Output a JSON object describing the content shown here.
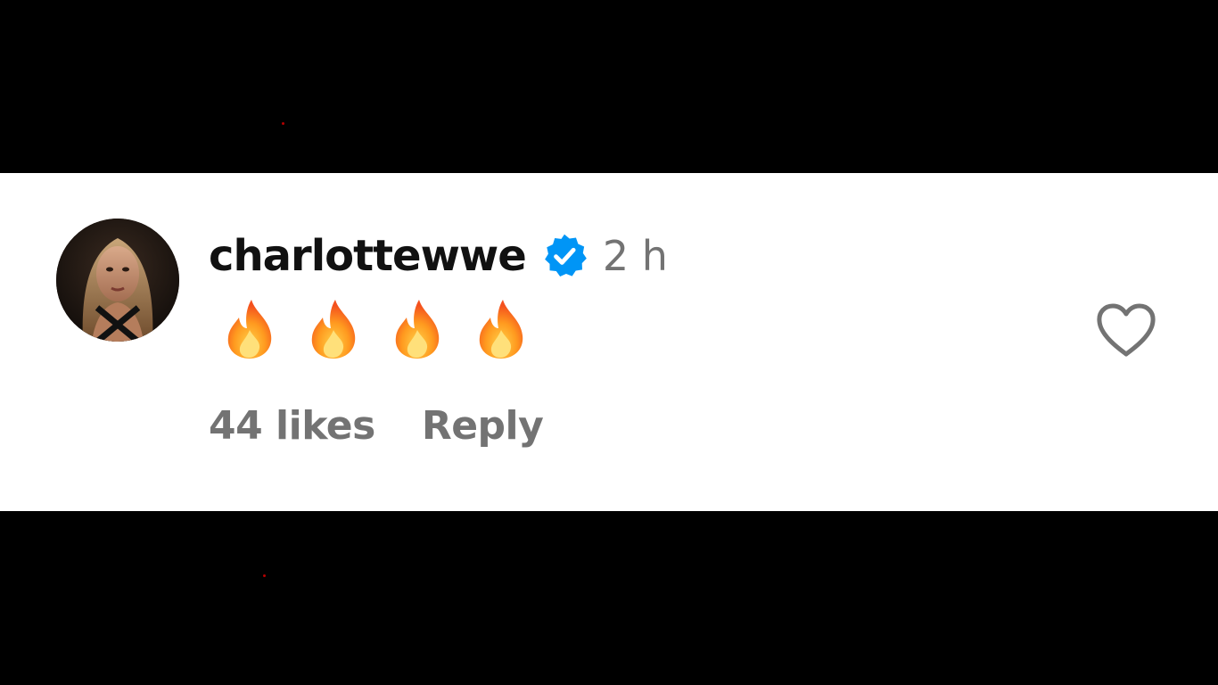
{
  "comment": {
    "username": "charlottewwe",
    "verified": true,
    "timestamp": "2 h",
    "text_emoji": [
      "fire-emoji",
      "fire-emoji",
      "fire-emoji",
      "fire-emoji"
    ],
    "likes_label": "44 likes",
    "reply_label": "Reply"
  },
  "icons": {
    "verified": "verified-badge-icon",
    "like": "heart-outline-icon",
    "avatar": "profile-avatar"
  },
  "colors": {
    "verified_badge": "#0095f6",
    "muted_text": "#737373",
    "username_text": "#111111",
    "background": "#ffffff"
  }
}
